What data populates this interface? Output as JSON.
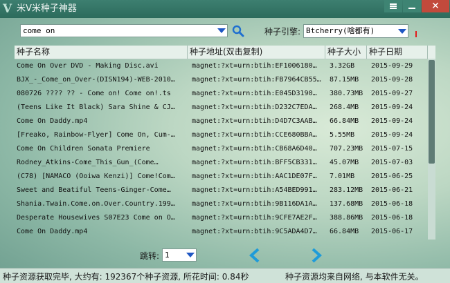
{
  "window": {
    "title": "米V米种子神器",
    "logo_glyph": "V"
  },
  "search": {
    "query": "come on",
    "engine_label": "种子引擎:",
    "engine_value": "Btcherry(啥都有)"
  },
  "table": {
    "columns": [
      "种子名称",
      "种子地址(双击复制)",
      "种子大小",
      "种子日期"
    ],
    "rows": [
      [
        "Come On Over DVD - Making Disc.avi",
        "magnet:?xt=urn:btih:EF1006180…",
        "3.32GB",
        "2015-09-29"
      ],
      [
        "BJX_-_Come_on_Over-(DISN194)-WEB-2010…",
        "magnet:?xt=urn:btih:FB7964CB55…",
        "87.15MB",
        "2015-09-28"
      ],
      [
        "080726 ???? ?? - Come on! Come on!.ts",
        "magnet:?xt=urn:btih:E045D3190…",
        "380.73MB",
        "2015-09-27"
      ],
      [
        "(Teens Like It Black) Sara Shine & CJ…",
        "magnet:?xt=urn:btih:D232C7EDA…",
        "268.4MB",
        "2015-09-24"
      ],
      [
        "Come On Daddy.mp4",
        "magnet:?xt=urn:btih:D4D7C3AAB…",
        "66.84MB",
        "2015-09-24"
      ],
      [
        "[Freako, Rainbow-Flyer] Come On, Cum-…",
        "magnet:?xt=urn:btih:CCE680BBA…",
        "5.55MB",
        "2015-09-24"
      ],
      [
        "Come On Children Sonata Premiere",
        "magnet:?xt=urn:btih:CB68A6D40…",
        "707.23MB",
        "2015-07-15"
      ],
      [
        "Rodney_Atkins-Come_This_Gun_(Come…",
        "magnet:?xt=urn:btih:BFF5CB331…",
        "45.07MB",
        "2015-07-03"
      ],
      [
        "(C78) [NAMACO (Ooiwa Kenzi)] Come!Com…",
        "magnet:?xt=urn:btih:AAC1DE07F…",
        "7.01MB",
        "2015-06-25"
      ],
      [
        "Sweet and Beatiful Teens-Ginger-Come…",
        "magnet:?xt=urn:btih:A54BED991…",
        "283.12MB",
        "2015-06-21"
      ],
      [
        "Shania.Twain.Come.on.Over.Country.199…",
        "magnet:?xt=urn:btih:9B116DA1A…",
        "137.68MB",
        "2015-06-18"
      ],
      [
        "Desperate Housewives S07E23 Come on O…",
        "magnet:?xt=urn:btih:9CFE7AE2F…",
        "388.86MB",
        "2015-06-18"
      ],
      [
        "Come On Daddy.mp4",
        "magnet:?xt=urn:btih:9C5ADA4D7…",
        "66.84MB",
        "2015-06-17"
      ]
    ]
  },
  "pager": {
    "jump_label": "跳转:",
    "page_value": "1"
  },
  "status": {
    "left": "种子资源获取完毕, 大约有: 192367个种子资源, 所花时间: 0.84秒",
    "right": "种子资源均来自网络, 与本软件无关。"
  },
  "colors": {
    "accent_blue": "#1f9bd9",
    "close_red": "#c24a3c",
    "titlebar": "#2c6b5c"
  },
  "icons": {
    "search": "search-icon",
    "prev": "arrow-left-icon",
    "next": "arrow-right-icon"
  }
}
